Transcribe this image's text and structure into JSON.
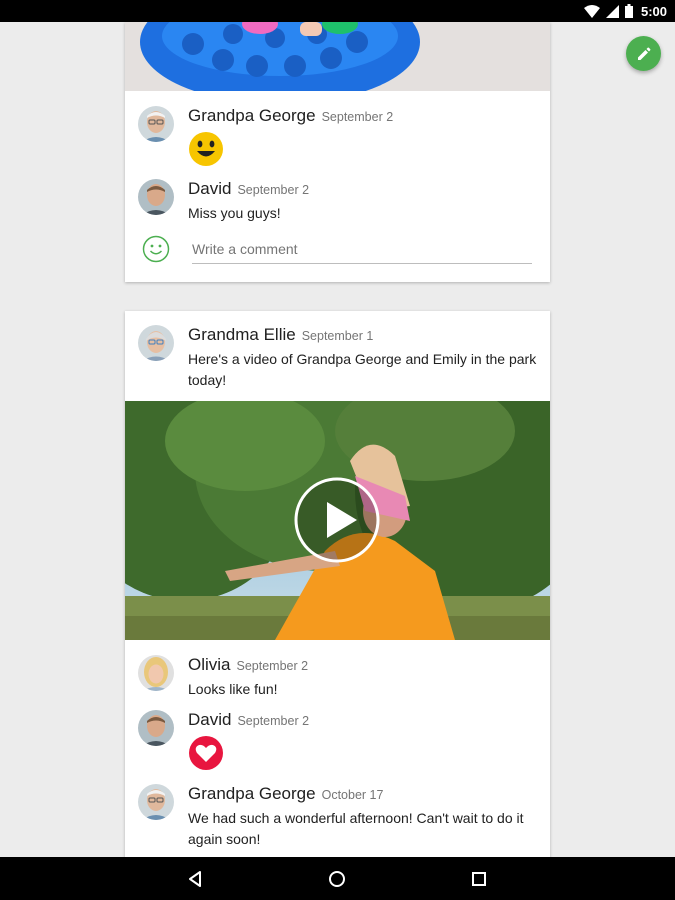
{
  "status_bar": {
    "time": "5:00"
  },
  "post1": {
    "comments": [
      {
        "author": "Grandpa George",
        "date": "September 2",
        "reaction": "smiley-emoji"
      },
      {
        "author": "David",
        "date": "September 2",
        "text": "Miss you guys!"
      }
    ],
    "compose": {
      "placeholder": "Write a comment"
    }
  },
  "post2": {
    "author": "Grandma Ellie",
    "date": "September 1",
    "text": "Here's a video of Grandpa George and Emily in the park today!",
    "comments": [
      {
        "author": "Olivia",
        "date": "September 2",
        "text": "Looks like fun!"
      },
      {
        "author": "David",
        "date": "September 2",
        "reaction": "heart-emoji"
      },
      {
        "author": "Grandpa George",
        "date": "October 17",
        "text": "We had such a wonderful afternoon! Can't wait to do it again soon!"
      }
    ]
  },
  "colors": {
    "fab": "#4caf50",
    "heart": "#e8163f",
    "smiley": "#f7c500"
  },
  "icons": {
    "fab": "pencil-icon",
    "compose": "smile-outline-icon",
    "nav_back": "back-triangle-icon",
    "nav_home": "home-circle-icon",
    "nav_recents": "recents-square-icon"
  }
}
